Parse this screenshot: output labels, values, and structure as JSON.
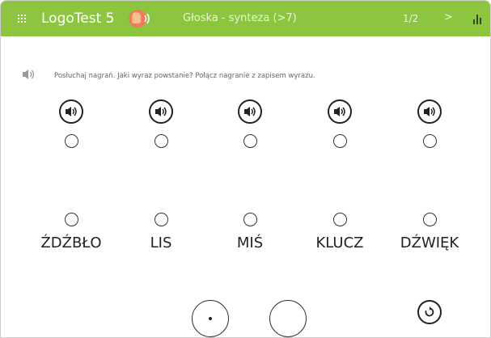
{
  "header": {
    "app_title": "LogoTest 5",
    "exercise_title": "Głoska - synteza (>7)",
    "counter": "1/2",
    "next_label": ">",
    "bar_color": "#8cc63f",
    "icons": [
      "grid-menu-icon",
      "logo-icon",
      "stats-icon"
    ]
  },
  "instruction": {
    "text": "Posłuchaj nagrań. Jaki wyraz powstanie? Połącz nagranie z zapisem wyrazu.",
    "icon": "speaker-icon"
  },
  "recordings": [
    {
      "icon": "speaker-icon"
    },
    {
      "icon": "speaker-icon"
    },
    {
      "icon": "speaker-icon"
    },
    {
      "icon": "speaker-icon"
    },
    {
      "icon": "speaker-icon"
    }
  ],
  "words": [
    "ŹDŹBŁO",
    "LIS",
    "MIŚ",
    "KLUCZ",
    "DŹWIĘK"
  ],
  "controls": {
    "icons": [
      "dot-circle-button",
      "empty-circle-button",
      "reset-icon"
    ]
  }
}
